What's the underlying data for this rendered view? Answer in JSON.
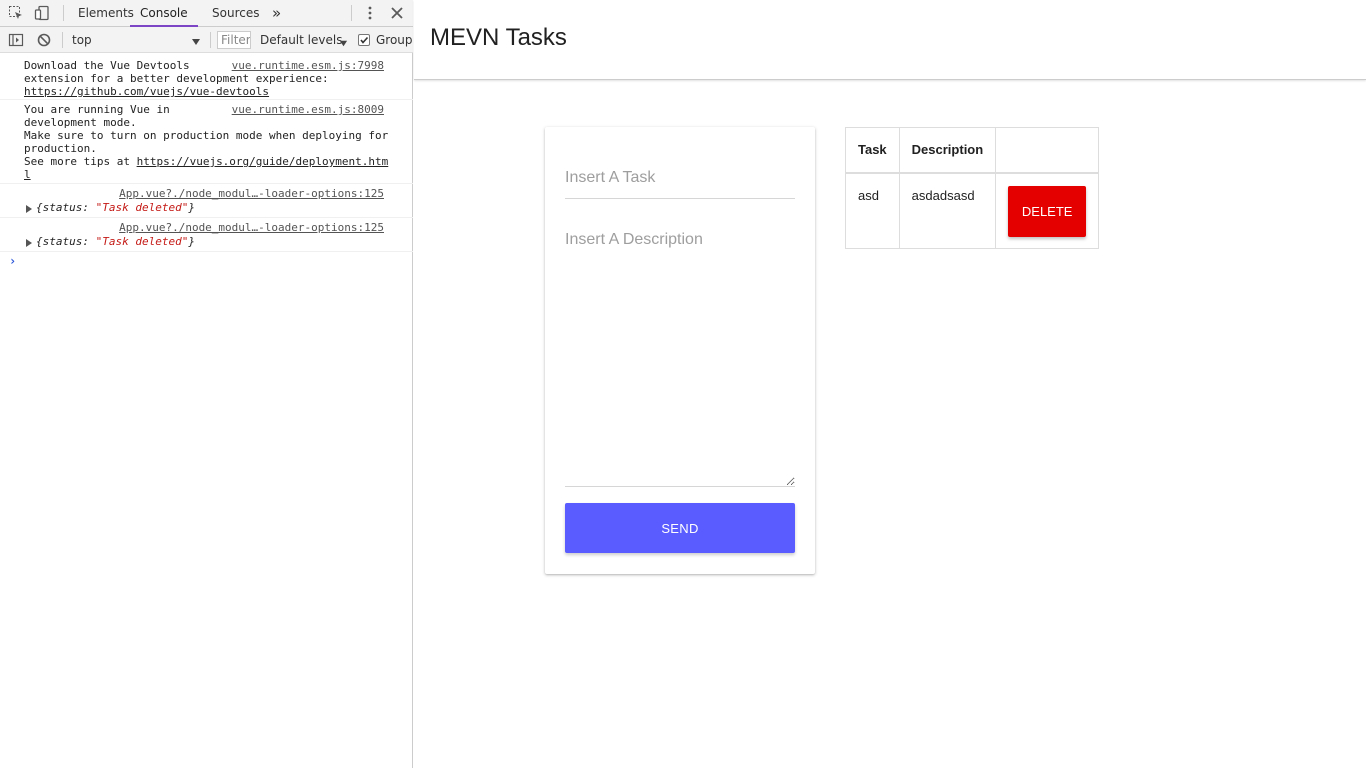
{
  "devtools": {
    "tabs": [
      {
        "label": "Elements",
        "active": false
      },
      {
        "label": "Console",
        "active": true
      },
      {
        "label": "Sources",
        "active": false
      }
    ],
    "more_tabs_glyph": "»",
    "context": "top",
    "filter_placeholder": "Filter",
    "levels_label": "Default levels",
    "group_label": "Group",
    "group_checked": true,
    "messages": [
      {
        "lines": [
          "Download the Vue Devtools",
          "extension for a better development experience:"
        ],
        "link": "https://github.com/vuejs/vue-devtools",
        "source": "vue.runtime.esm.js:7998"
      },
      {
        "lines": [
          "You are running Vue in",
          "development mode.",
          "Make sure to turn on production mode when deploying for",
          "production."
        ],
        "tip_prefix": "See more tips at ",
        "link_part1": "https://vuejs.org/guide/deployment.htm",
        "link_part2": "l",
        "source": "vue.runtime.esm.js:8009"
      },
      {
        "source": "App.vue?./node_modul…-loader-options:125",
        "object_key": "status",
        "object_value": "\"Task deleted\""
      },
      {
        "source": "App.vue?./node_modul…-loader-options:125",
        "object_key": "status",
        "object_value": "\"Task deleted\""
      }
    ],
    "prompt_glyph": "›"
  },
  "app": {
    "brand": "MEVN Tasks",
    "form": {
      "task_placeholder": "Insert A Task",
      "description_placeholder": "Insert A Description",
      "send_label": "SEND"
    },
    "table": {
      "headers": [
        "Task",
        "Description"
      ],
      "rows": [
        {
          "task": "asd",
          "description": "asdadsasd",
          "delete_label": "DELETE"
        }
      ]
    },
    "colors": {
      "send_button": "#5b5cff",
      "delete_button": "#e50000",
      "active_tab_underline": "#7b45c6"
    }
  }
}
